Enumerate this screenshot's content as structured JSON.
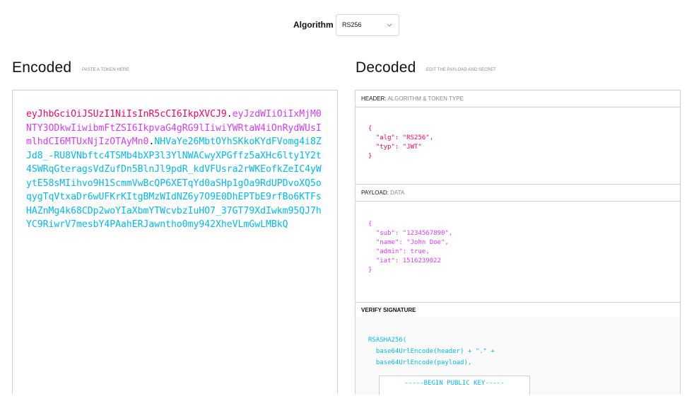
{
  "algorithm": {
    "label": "Algorithm",
    "selected": "RS256",
    "chevron_icon": "chevron-down-icon"
  },
  "encoded": {
    "title": "Encoded",
    "subtitle": "PASTE A TOKEN HERE",
    "token_header": "eyJhbGciOiJSUzI1NiIsInR5cCI6IkpXVCJ9",
    "token_payload": "eyJzdWIiOiIxMjM0NTY3ODkwIiwibmFtZSI6IkpvaG4gRG9lIiwiYWRtaW4iOnRydWUsImlhdCI6MTUxNjIzOTAyMn0",
    "token_signature": "NHVaYe26MbtOYhSKkoKYdFVomg4i8ZJd8_-RU8VNbftc4TSMb4bXP3l3YlNWACwyXPGffz5aXHc6lty1Y2t4SWRqGteragsVdZufDn5BlnJl9pdR_kdVFUsra2rWKEofkZeIC4yWytE58sMIihvo9H1ScmmVwBcQP6XETqYd0aSHp1gOa9RdUPDvoXQ5oqygTqVtxaDr6wUFKrKItgBMzWIdNZ6y7O9E0DhEPTbE9rfBo6KTFsHAZnMg4k68CDp2woYIaXbmYTWcvbzIuHO7_37GT79XdIwkm95QJ7hYC9RiwrV7mesbY4PAahERJawntho0my942XheVLmGwLMBkQ",
    "dot": "."
  },
  "decoded": {
    "title": "Decoded",
    "subtitle": "EDIT THE PAYLOAD AND SECRET",
    "header_panel": {
      "label": "HEADER:",
      "sublabel": "ALGORITHM & TOKEN TYPE",
      "code": "{\n  \"alg\": \"RS256\",\n  \"typ\": \"JWT\"\n}"
    },
    "payload_panel": {
      "label": "PAYLOAD:",
      "sublabel": "DATA",
      "code": "{\n  \"sub\": \"1234567890\",\n  \"name\": \"John Doe\",\n  \"admin\": true,\n  \"iat\": 1516239022\n}"
    },
    "signature_panel": {
      "label": "VERIFY SIGNATURE",
      "code": "RSASHA256(\n  base64UrlEncode(header) + \".\" +\n  base64UrlEncode(payload),",
      "public_key": "-----BEGIN PUBLIC KEY-----"
    }
  },
  "colors": {
    "header": "#fb015b",
    "payload": "#d63aff",
    "signature": "#00b9f1"
  }
}
